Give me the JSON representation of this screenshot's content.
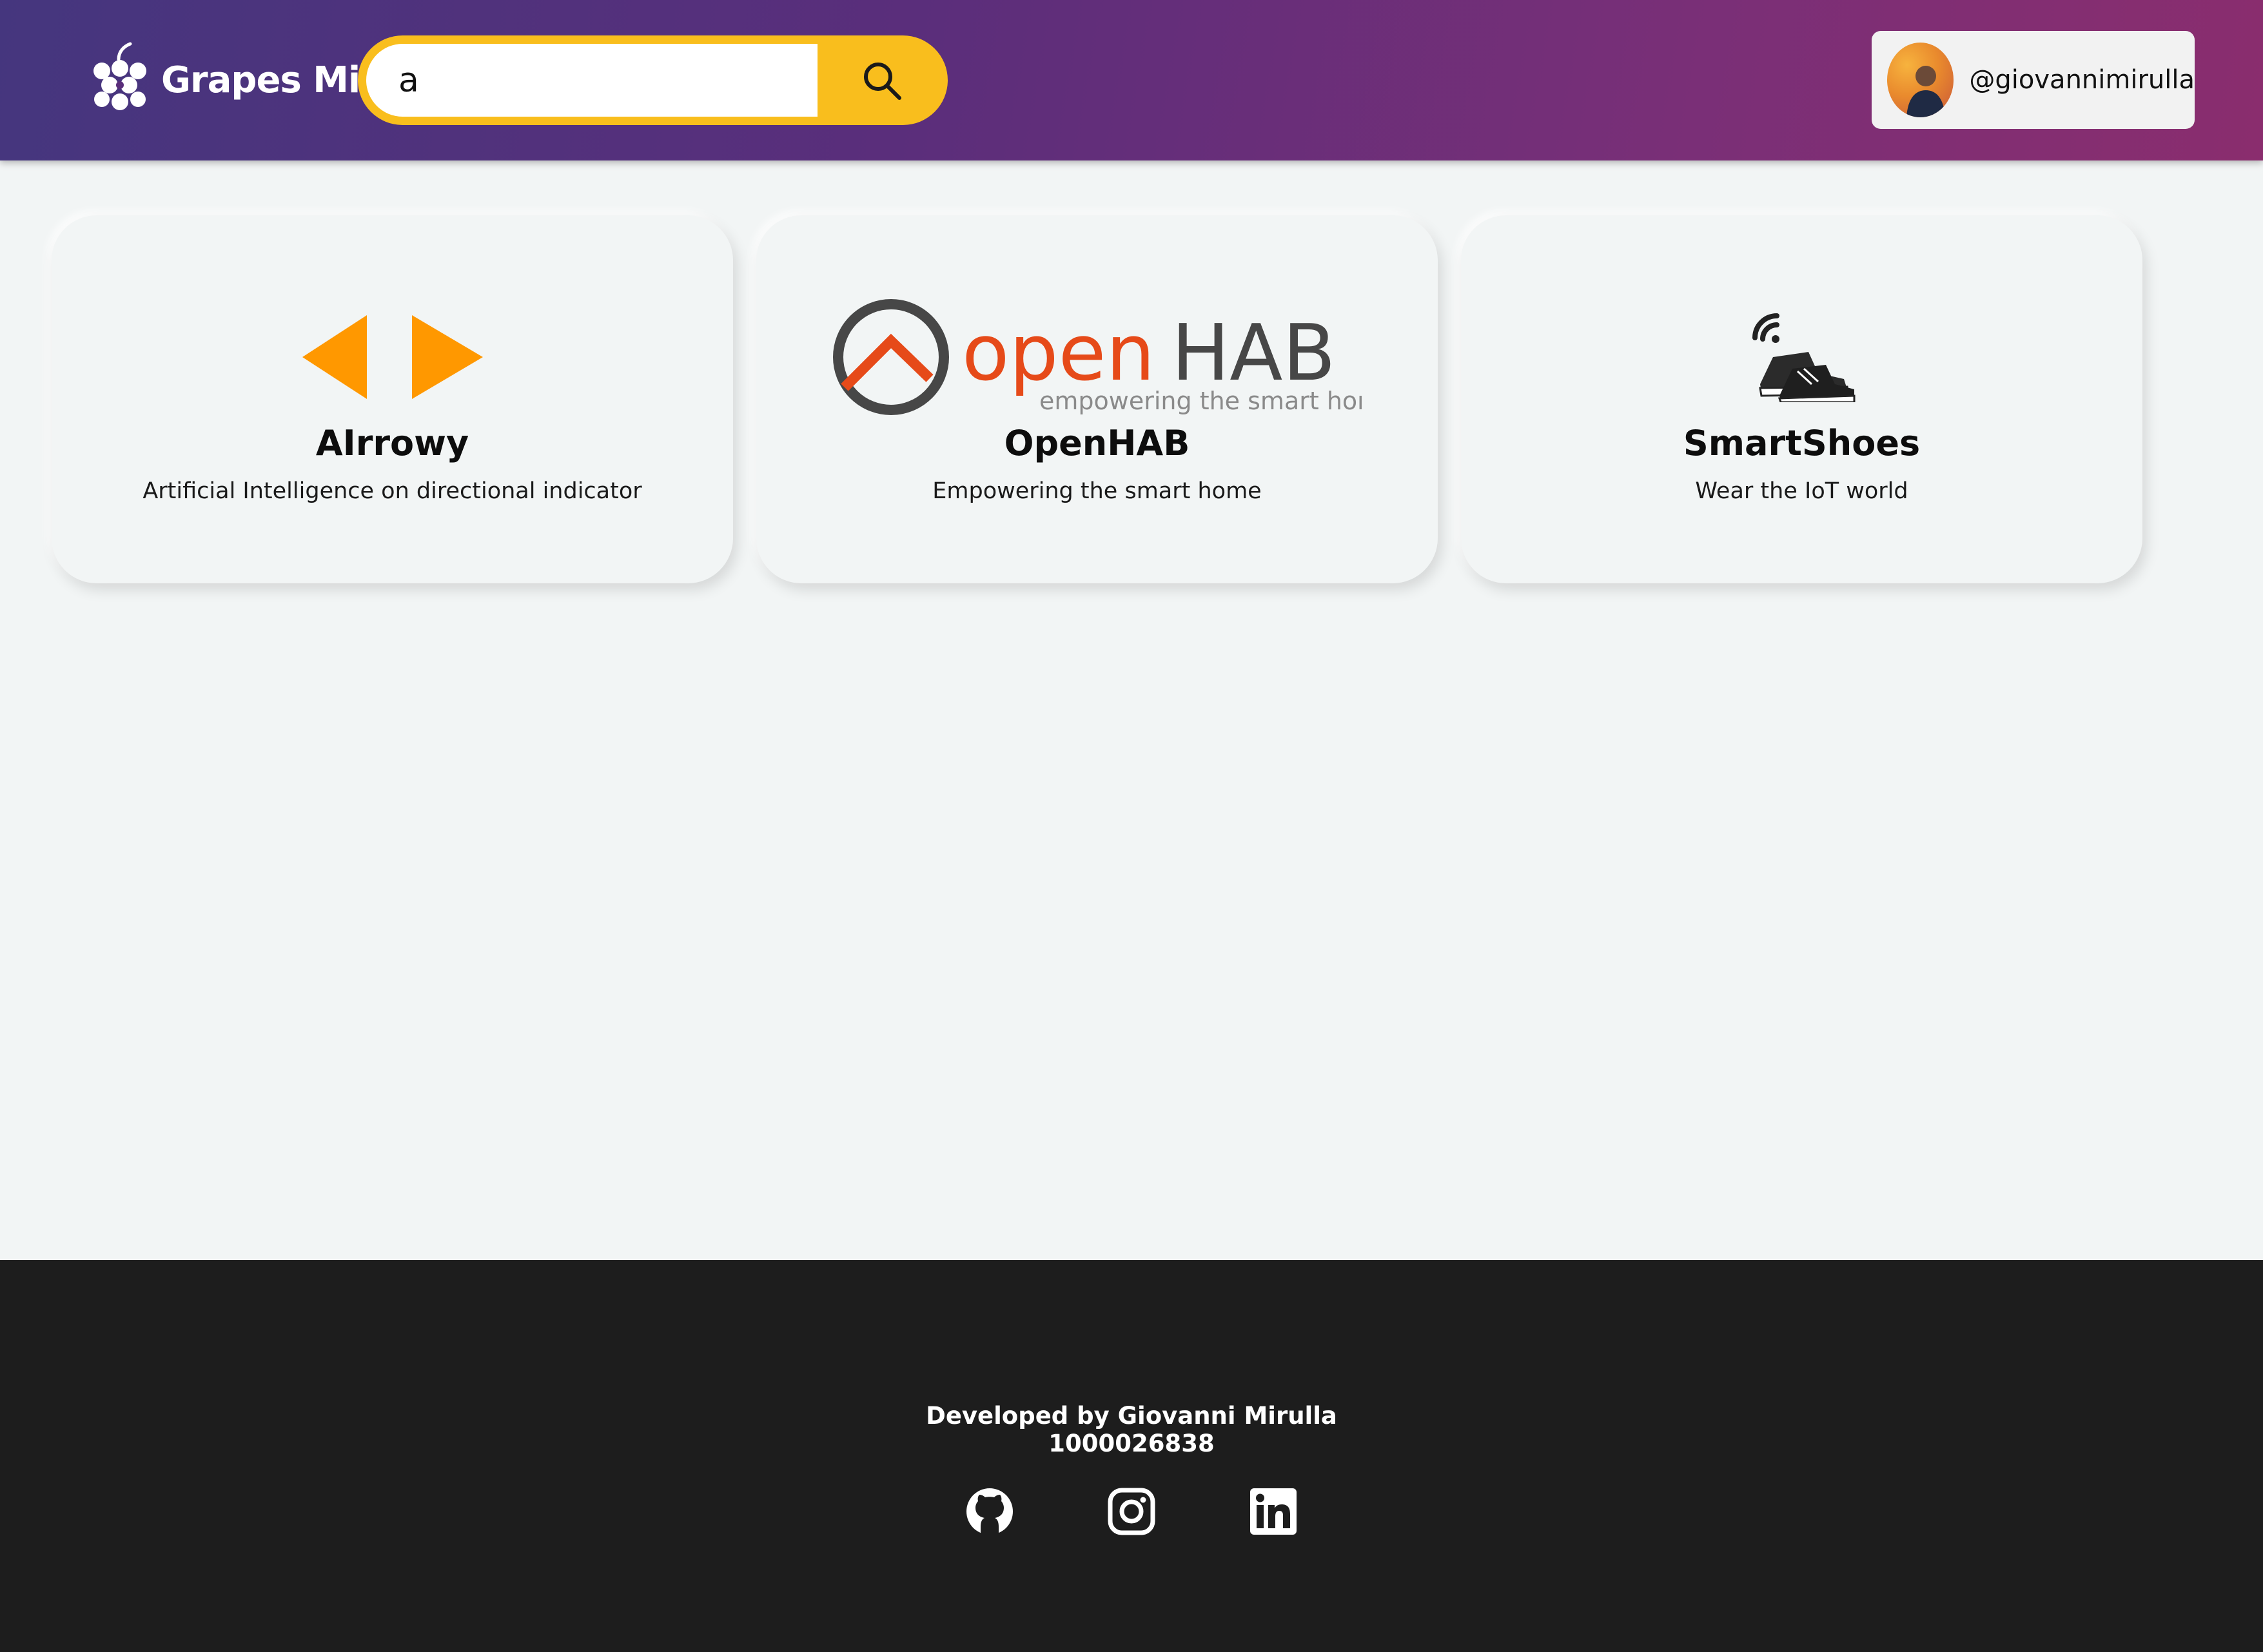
{
  "header": {
    "brand_name": "Grapes Mi",
    "search": {
      "value": "a",
      "placeholder": ""
    },
    "user": {
      "username": "@giovannimirulla"
    }
  },
  "projects": [
    {
      "title": "AIrrowy",
      "description": "Artificial Intelligence on directional indicator",
      "icon": "left-right-arrows"
    },
    {
      "title": "OpenHAB",
      "description": "Empowering the smart home",
      "logo_text": "openHAB",
      "logo_tagline": "empowering the smart home"
    },
    {
      "title": "SmartShoes",
      "description": "Wear the IoT world",
      "icon": "connected-sneakers"
    }
  ],
  "footer": {
    "developer": "Developed by Giovanni Mirulla",
    "id": "1000026838",
    "social": [
      "github-icon",
      "instagram-icon",
      "linkedin-icon"
    ]
  },
  "colors": {
    "header_gradient_start": "#45367e",
    "header_gradient_end": "#8a2d6e",
    "search_accent": "#f9be1d",
    "arrow_orange": "#ff9800",
    "openhab_orange": "#e64a19",
    "openhab_gray": "#474747",
    "footer_bg": "#1d1d1d",
    "page_bg": "#f2f5f5"
  }
}
